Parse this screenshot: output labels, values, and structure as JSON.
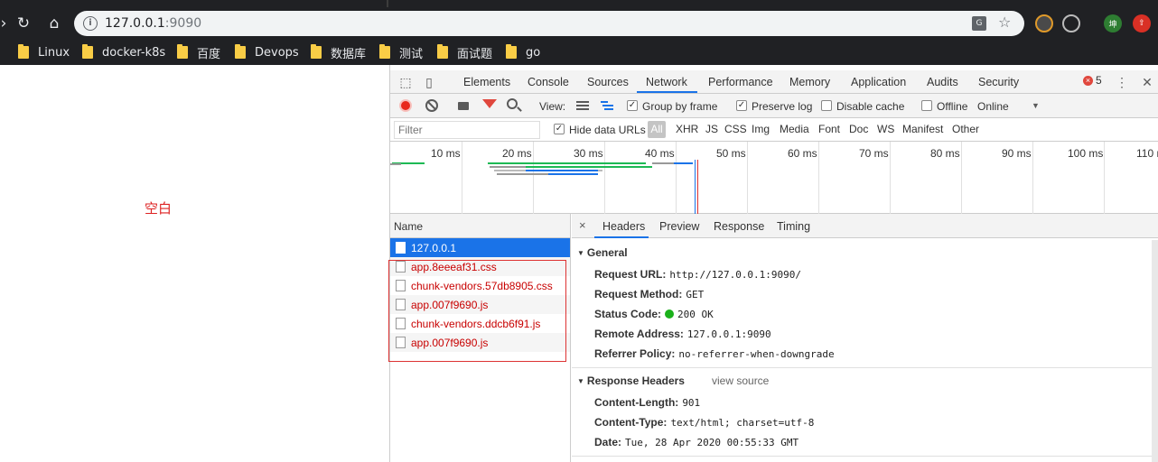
{
  "browser": {
    "url_host": "127.0.0.1",
    "url_port": ":9090",
    "bookmarks": [
      "Linux",
      "docker-k8s",
      "百度",
      "Devops",
      "数据库",
      "测试",
      "面试题",
      "go"
    ]
  },
  "page": {
    "blank_text": "空白"
  },
  "devtools": {
    "tabs": [
      "Elements",
      "Console",
      "Sources",
      "Network",
      "Performance",
      "Memory",
      "Application",
      "Audits",
      "Security"
    ],
    "active_tab": "Network",
    "error_count": "5",
    "toolbar": {
      "view_label": "View:",
      "group_by_frame": "Group by frame",
      "preserve_log": "Preserve log",
      "disable_cache": "Disable cache",
      "offline": "Offline",
      "throttle": "Online"
    },
    "filter": {
      "placeholder": "Filter",
      "hide_data_urls": "Hide data URLs",
      "types": [
        "All",
        "XHR",
        "JS",
        "CSS",
        "Img",
        "Media",
        "Font",
        "Doc",
        "WS",
        "Manifest",
        "Other"
      ]
    },
    "overview_ticks": [
      "10 ms",
      "20 ms",
      "30 ms",
      "40 ms",
      "50 ms",
      "60 ms",
      "70 ms",
      "80 ms",
      "90 ms",
      "100 ms",
      "110 ms"
    ],
    "requests": {
      "header": "Name",
      "items": [
        "127.0.0.1",
        "app.8eeeaf31.css",
        "chunk-vendors.57db8905.css",
        "app.007f9690.js",
        "chunk-vendors.ddcb6f91.js",
        "app.007f9690.js"
      ]
    },
    "detail": {
      "close": "×",
      "tabs": [
        "Headers",
        "Preview",
        "Response",
        "Timing"
      ],
      "general": {
        "title": "General",
        "request_url_k": "Request URL:",
        "request_url_v": "http://127.0.0.1:9090/",
        "method_k": "Request Method:",
        "method_v": "GET",
        "status_k": "Status Code:",
        "status_v": "200 OK",
        "remote_k": "Remote Address:",
        "remote_v": "127.0.0.1:9090",
        "referrer_k": "Referrer Policy:",
        "referrer_v": "no-referrer-when-downgrade"
      },
      "response_headers": {
        "title": "Response Headers",
        "view_source": "view source",
        "length_k": "Content-Length:",
        "length_v": "901",
        "type_k": "Content-Type:",
        "type_v": "text/html; charset=utf-8",
        "date_k": "Date:",
        "date_v": "Tue, 28 Apr 2020 00:55:33 GMT"
      }
    }
  }
}
